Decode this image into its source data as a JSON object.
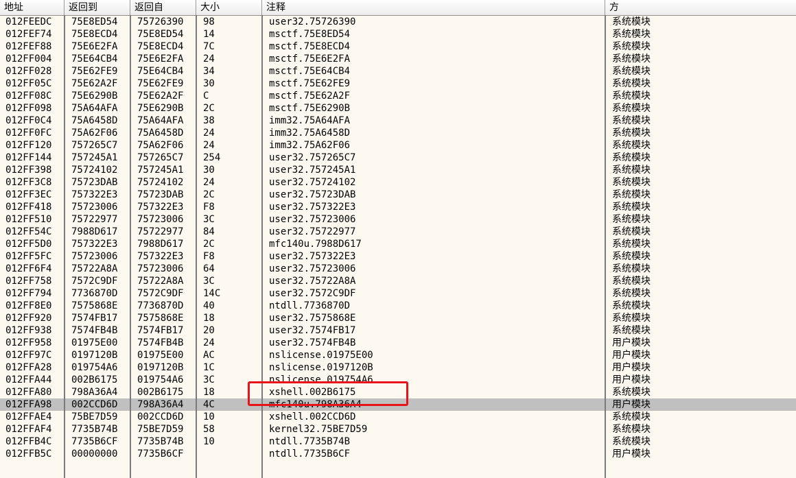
{
  "columns": [
    {
      "key": "addr",
      "label": "地址"
    },
    {
      "key": "ret_to",
      "label": "返回到"
    },
    {
      "key": "ret_from",
      "label": "返回自"
    },
    {
      "key": "size",
      "label": "大小"
    },
    {
      "key": "comment",
      "label": "注释"
    },
    {
      "key": "party",
      "label": "方"
    }
  ],
  "selected_row": 31,
  "highlight_color": "#e8121a",
  "rows": [
    {
      "addr": "012FEEDC",
      "ret_to": "75E8ED54",
      "ret_from": "75726390",
      "size": "98",
      "comment": "user32.75726390",
      "party": "系统模块"
    },
    {
      "addr": "012FEF74",
      "ret_to": "75E8ECD4",
      "ret_from": "75E8ED54",
      "size": "14",
      "comment": "msctf.75E8ED54",
      "party": "系统模块"
    },
    {
      "addr": "012FEF88",
      "ret_to": "75E6E2FA",
      "ret_from": "75E8ECD4",
      "size": "7C",
      "comment": "msctf.75E8ECD4",
      "party": "系统模块"
    },
    {
      "addr": "012FF004",
      "ret_to": "75E64CB4",
      "ret_from": "75E6E2FA",
      "size": "24",
      "comment": "msctf.75E6E2FA",
      "party": "系统模块"
    },
    {
      "addr": "012FF028",
      "ret_to": "75E62FE9",
      "ret_from": "75E64CB4",
      "size": "34",
      "comment": "msctf.75E64CB4",
      "party": "系统模块"
    },
    {
      "addr": "012FF05C",
      "ret_to": "75E62A2F",
      "ret_from": "75E62FE9",
      "size": "30",
      "comment": "msctf.75E62FE9",
      "party": "系统模块"
    },
    {
      "addr": "012FF08C",
      "ret_to": "75E6290B",
      "ret_from": "75E62A2F",
      "size": "C",
      "comment": "msctf.75E62A2F",
      "party": "系统模块"
    },
    {
      "addr": "012FF098",
      "ret_to": "75A64AFA",
      "ret_from": "75E6290B",
      "size": "2C",
      "comment": "msctf.75E6290B",
      "party": "系统模块"
    },
    {
      "addr": "012FF0C4",
      "ret_to": "75A6458D",
      "ret_from": "75A64AFA",
      "size": "38",
      "comment": "imm32.75A64AFA",
      "party": "系统模块"
    },
    {
      "addr": "012FF0FC",
      "ret_to": "75A62F06",
      "ret_from": "75A6458D",
      "size": "24",
      "comment": "imm32.75A6458D",
      "party": "系统模块"
    },
    {
      "addr": "012FF120",
      "ret_to": "757265C7",
      "ret_from": "75A62F06",
      "size": "24",
      "comment": "imm32.75A62F06",
      "party": "系统模块"
    },
    {
      "addr": "012FF144",
      "ret_to": "757245A1",
      "ret_from": "757265C7",
      "size": "254",
      "comment": "user32.757265C7",
      "party": "系统模块"
    },
    {
      "addr": "012FF398",
      "ret_to": "75724102",
      "ret_from": "757245A1",
      "size": "30",
      "comment": "user32.757245A1",
      "party": "系统模块"
    },
    {
      "addr": "012FF3C8",
      "ret_to": "75723DAB",
      "ret_from": "75724102",
      "size": "24",
      "comment": "user32.75724102",
      "party": "系统模块"
    },
    {
      "addr": "012FF3EC",
      "ret_to": "757322E3",
      "ret_from": "75723DAB",
      "size": "2C",
      "comment": "user32.75723DAB",
      "party": "系统模块"
    },
    {
      "addr": "012FF418",
      "ret_to": "75723006",
      "ret_from": "757322E3",
      "size": "F8",
      "comment": "user32.757322E3",
      "party": "系统模块"
    },
    {
      "addr": "012FF510",
      "ret_to": "75722977",
      "ret_from": "75723006",
      "size": "3C",
      "comment": "user32.75723006",
      "party": "系统模块"
    },
    {
      "addr": "012FF54C",
      "ret_to": "7988D617",
      "ret_from": "75722977",
      "size": "84",
      "comment": "user32.75722977",
      "party": "系统模块"
    },
    {
      "addr": "012FF5D0",
      "ret_to": "757322E3",
      "ret_from": "7988D617",
      "size": "2C",
      "comment": "mfc140u.7988D617",
      "party": "系统模块"
    },
    {
      "addr": "012FF5FC",
      "ret_to": "75723006",
      "ret_from": "757322E3",
      "size": "F8",
      "comment": "user32.757322E3",
      "party": "系统模块"
    },
    {
      "addr": "012FF6F4",
      "ret_to": "75722A8A",
      "ret_from": "75723006",
      "size": "64",
      "comment": "user32.75723006",
      "party": "系统模块"
    },
    {
      "addr": "012FF758",
      "ret_to": "7572C9DF",
      "ret_from": "75722A8A",
      "size": "3C",
      "comment": "user32.75722A8A",
      "party": "系统模块"
    },
    {
      "addr": "012FF794",
      "ret_to": "7736870D",
      "ret_from": "7572C9DF",
      "size": "14C",
      "comment": "user32.7572C9DF",
      "party": "系统模块"
    },
    {
      "addr": "012FF8E0",
      "ret_to": "7575868E",
      "ret_from": "7736870D",
      "size": "40",
      "comment": "ntdll.7736870D",
      "party": "系统模块"
    },
    {
      "addr": "012FF920",
      "ret_to": "7574FB17",
      "ret_from": "7575868E",
      "size": "18",
      "comment": "user32.7575868E",
      "party": "系统模块"
    },
    {
      "addr": "012FF938",
      "ret_to": "7574FB4B",
      "ret_from": "7574FB17",
      "size": "20",
      "comment": "user32.7574FB17",
      "party": "系统模块"
    },
    {
      "addr": "012FF958",
      "ret_to": "01975E00",
      "ret_from": "7574FB4B",
      "size": "24",
      "comment": "user32.7574FB4B",
      "party": "用户模块"
    },
    {
      "addr": "012FF97C",
      "ret_to": "0197120B",
      "ret_from": "01975E00",
      "size": "AC",
      "comment": "nslicense.01975E00",
      "party": "用户模块"
    },
    {
      "addr": "012FFA28",
      "ret_to": "019754A6",
      "ret_from": "0197120B",
      "size": "1C",
      "comment": "nslicense.0197120B",
      "party": "用户模块"
    },
    {
      "addr": "012FFA44",
      "ret_to": "002B6175",
      "ret_from": "019754A6",
      "size": "3C",
      "comment": "nslicense.019754A6",
      "party": "用户模块"
    },
    {
      "addr": "012FFA80",
      "ret_to": "798A36A4",
      "ret_from": "002B6175",
      "size": "18",
      "comment": "xshell.002B6175",
      "party": "系统模块"
    },
    {
      "addr": "012FFA98",
      "ret_to": "002CCD6D",
      "ret_from": "798A36A4",
      "size": "4C",
      "comment": "mfc140u.798A36A4",
      "party": "用户模块"
    },
    {
      "addr": "012FFAE4",
      "ret_to": "75BE7D59",
      "ret_from": "002CCD6D",
      "size": "10",
      "comment": "xshell.002CCD6D",
      "party": "系统模块"
    },
    {
      "addr": "012FFAF4",
      "ret_to": "7735B74B",
      "ret_from": "75BE7D59",
      "size": "58",
      "comment": "kernel32.75BE7D59",
      "party": "系统模块"
    },
    {
      "addr": "012FFB4C",
      "ret_to": "7735B6CF",
      "ret_from": "7735B74B",
      "size": "10",
      "comment": "ntdll.7735B74B",
      "party": "系统模块"
    },
    {
      "addr": "012FFB5C",
      "ret_to": "00000000",
      "ret_from": "7735B6CF",
      "size": "",
      "comment": "ntdll.7735B6CF",
      "party": "用户模块"
    }
  ]
}
